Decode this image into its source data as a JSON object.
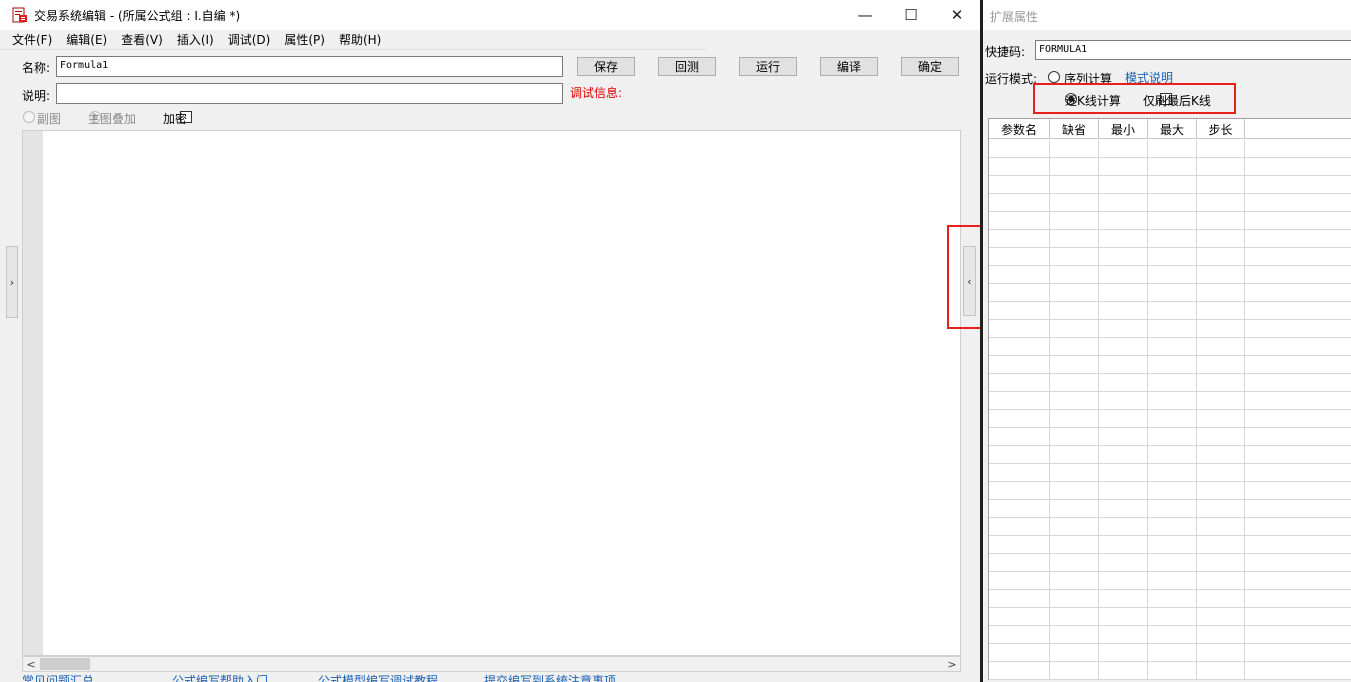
{
  "window": {
    "title": "交易系统编辑 - (所属公式组 : I.自编 *)",
    "minimize": "—",
    "maximize": "☐",
    "close": "✕"
  },
  "menu": [
    "文件(F)",
    "编辑(E)",
    "查看(V)",
    "插入(I)",
    "调试(D)",
    "属性(P)",
    "帮助(H)"
  ],
  "form": {
    "name_label": "名称:",
    "name_value": "Formula1",
    "desc_label": "说明:",
    "desc_value": "",
    "debug_label": "调试信息:",
    "buttons": {
      "save": "保存",
      "backtest": "回测",
      "run": "运行",
      "compile": "编译",
      "ok": "确定"
    },
    "radio_subchart": "副图",
    "radio_overlay": "主图叠加",
    "checkbox_encrypt": "加密"
  },
  "toggles": {
    "left": "›",
    "right": "‹"
  },
  "scroll": {
    "left": "<",
    "right": ">"
  },
  "bottom_links": [
    "常见问题汇总",
    "公式编写帮助入门",
    "公式模型编写调试教程",
    "提交编写到系统注意事项"
  ],
  "side_panel": {
    "title": "扩展属性",
    "shortcut_label": "快捷码:",
    "shortcut_value": "FORMULA1",
    "mode_label": "运行模式:",
    "mode_sequence": "序列计算",
    "mode_help": "模式说明",
    "mode_each_bar": "逐K线计算",
    "only_last_bar": "仅刷最后K线",
    "table": {
      "headers": [
        "参数名",
        "缺省",
        "最小",
        "最大",
        "步长"
      ],
      "row_count": 30
    }
  }
}
